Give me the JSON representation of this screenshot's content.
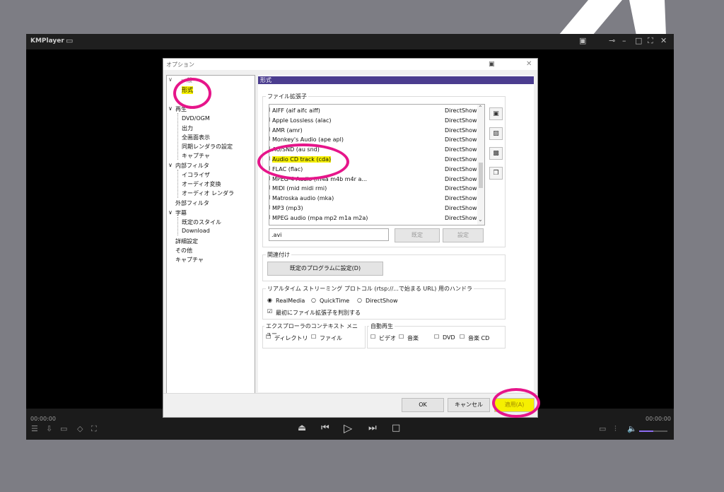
{
  "player": {
    "brand": "KMPlayer",
    "time_left": "00:00:00",
    "time_right": "00:00:00",
    "volume_fraction": 0.5
  },
  "dialog": {
    "title": "オプション",
    "tree": [
      "形式",
      "再生",
      "DVD/OGM",
      "出力",
      "全画面表示",
      "同期レンダラの設定",
      "キャプチャ",
      "内部フィルタ",
      "イコライザ",
      "オーディオ変換",
      "オーディオ レンダラ",
      "外部フィルタ",
      "字幕",
      "既定のスタイル",
      "Download",
      "詳細設定",
      "その他",
      "キャプチャ"
    ],
    "panel_title": "形式",
    "ext_group": "ファイル拡張子",
    "ext_rows": [
      {
        "name": "AIFF (aif aifc aiff)",
        "filter": "DirectShow",
        "checked": false
      },
      {
        "name": "Apple Lossless (alac)",
        "filter": "DirectShow",
        "checked": false
      },
      {
        "name": "AMR (amr)",
        "filter": "DirectShow",
        "checked": false
      },
      {
        "name": "Monkey's Audio (ape apl)",
        "filter": "DirectShow",
        "checked": false
      },
      {
        "name": "AU/SND (au snd)",
        "filter": "DirectShow",
        "checked": false
      },
      {
        "name": "Audio CD track (cda)",
        "filter": "DirectShow",
        "checked": true
      },
      {
        "name": "FLAC (flac)",
        "filter": "DirectShow",
        "checked": false
      },
      {
        "name": "MPEG-4 Audio (m4a m4b m4r a...",
        "filter": "DirectShow",
        "checked": false
      },
      {
        "name": "MIDI (mid midi rmi)",
        "filter": "DirectShow",
        "checked": false
      },
      {
        "name": "Matroska audio (mka)",
        "filter": "DirectShow",
        "checked": false
      },
      {
        "name": "MP3 (mp3)",
        "filter": "DirectShow",
        "checked": false
      },
      {
        "name": "MPEG audio (mpa mp2 m1a m2a)",
        "filter": "DirectShow",
        "checked": false
      }
    ],
    "ext_input": ".avi",
    "btn_default": "既定",
    "btn_settings": "設定",
    "assoc_group": "関連付け",
    "btn_set_default_program": "既定のプログラムに設定(D)",
    "rtsp_group": "リアルタイム ストリーミング プロトコル (rtsp://...で始まる URL) 用のハンドラ",
    "radio_realmedia": "RealMedia",
    "radio_quicktime": "QuickTime",
    "radio_directshow": "DirectShow",
    "check_detect_ext": "最初にファイル拡張子を判別する",
    "ctx_group": "エクスプローラのコンテキスト メニュー",
    "ctx_directory": "ディレクトリ",
    "ctx_file": "ファイル",
    "auto_group": "自動再生",
    "auto_video": "ビデオ",
    "auto_music": "音楽",
    "auto_dvd": "DVD",
    "auto_cd": "音楽 CD",
    "btn_ok": "OK",
    "btn_cancel": "キャンセル",
    "btn_apply": "適用(A)"
  },
  "colors": {
    "highlight": "#f6f000",
    "annotation": "#e6158a",
    "panel_header": "#4b3d8f"
  }
}
